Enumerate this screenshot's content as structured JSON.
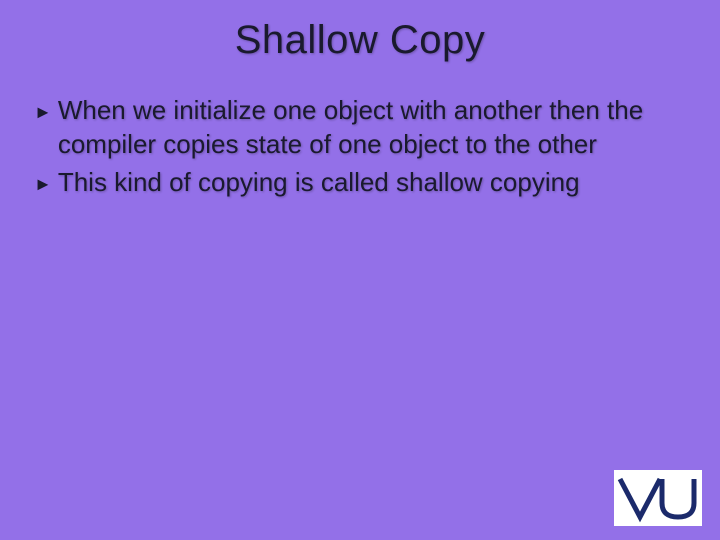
{
  "title": "Shallow Copy",
  "bullets": [
    {
      "text": "When we initialize one object with another then the compiler copies state of one object to the other"
    },
    {
      "text": "This kind of copying is called shallow copying"
    }
  ],
  "bullet_marker": "►",
  "logo_text": "VU"
}
